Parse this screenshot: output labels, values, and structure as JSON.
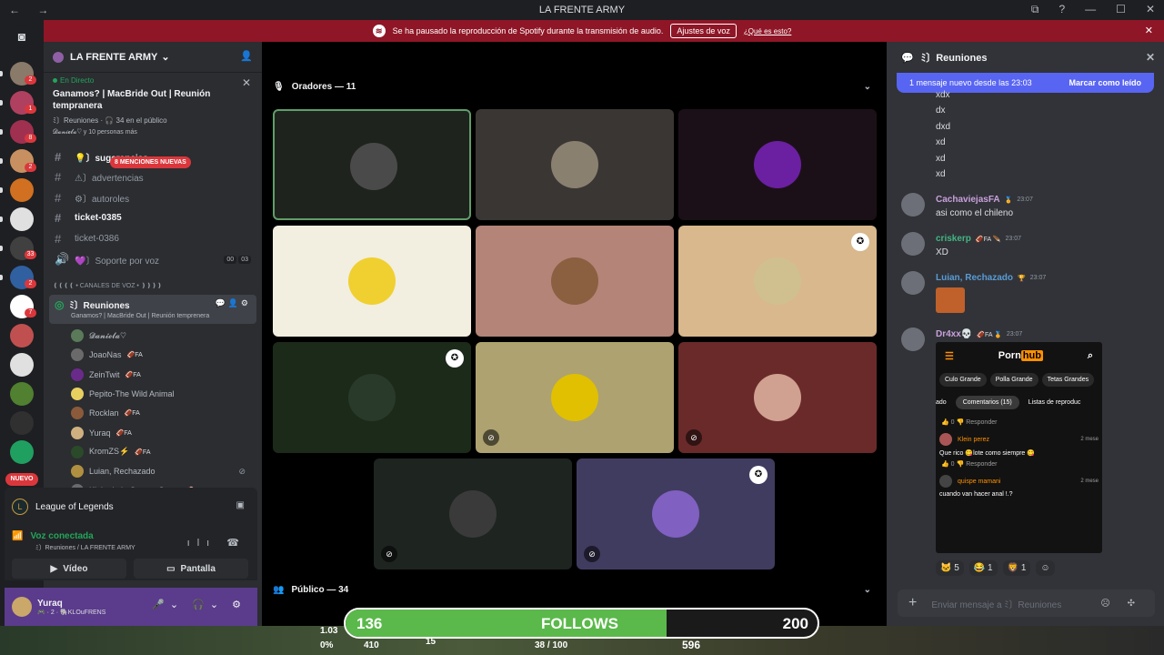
{
  "window": {
    "title": "LA FRENTE ARMY",
    "nav": "← →",
    "controls": [
      "⧉",
      "?",
      "—",
      "☐",
      "✕"
    ]
  },
  "banner": {
    "text": "Se ha pausado la reproducción de Spotify durante la transmisión de audio.",
    "button": "Ajustes de voz",
    "link": "¿Qué es esto?"
  },
  "guilds": [
    {
      "badge": "2",
      "color": "#8a7a6a"
    },
    {
      "badge": "1",
      "color": "#b04060"
    },
    {
      "badge": "8",
      "color": "#a03050"
    },
    {
      "badge": "2",
      "color": "#c89060"
    },
    {
      "badge": "",
      "color": "#d07020"
    },
    {
      "badge": "",
      "color": "#e0e0e0"
    },
    {
      "badge": "33",
      "color": "#404040"
    },
    {
      "badge": "2",
      "color": "#3060a0"
    },
    {
      "badge": "7",
      "color": "#ffffff"
    },
    {
      "badge": "",
      "color": "#c05050"
    },
    {
      "badge": "",
      "color": "#e0e0e0"
    },
    {
      "badge": "",
      "color": "#508030"
    },
    {
      "badge": "",
      "color": "#303030"
    },
    {
      "badge": "",
      "color": "#20a060"
    }
  ],
  "guild_new": "NUEVO",
  "server": {
    "name": "LA FRENTE ARMY"
  },
  "stage_card": {
    "live": "En Directo",
    "title": "Ganamos? | MacBride Out | Reunión tempranera",
    "channel": "ﾐ〕Reuniones",
    "audience": "34 en el público",
    "people": "𝓓𝓪𝓷𝓲𝓮𝓵𝓪♡ y 10 personas más"
  },
  "channels": [
    {
      "icon": "#",
      "name": "💡〕sugerencias",
      "unread": true
    },
    {
      "icon": "#",
      "name": "⚠〕advertencias",
      "unread": false
    },
    {
      "icon": "#",
      "name": "⚙〕autoroles",
      "unread": false
    },
    {
      "icon": "#",
      "name": "ticket-0385",
      "unread": true
    },
    {
      "icon": "#",
      "name": "ticket-0386",
      "unread": false
    },
    {
      "icon": "🔊",
      "name": "💜〕Soporte por voz",
      "unread": false
    }
  ],
  "mentions_badge": "8 MENCIONES NUEVAS",
  "voice_tags": [
    "00",
    "03"
  ],
  "voice_category": "❪❪❪❪ • CANALES DE VOZ • ❫❫❫❫",
  "voice_channel": {
    "name": "ﾐ〕Reuniones",
    "sub": "Ganamos? | MacBride Out | Reunión temprenera"
  },
  "voice_users": [
    {
      "name": "𝓓𝓪𝓷𝓲𝓮𝓵𝓪♡",
      "fa": "",
      "color": "#5a7a5a"
    },
    {
      "name": "JoaoNas",
      "fa": "🏈FA",
      "color": "#6a6a6a"
    },
    {
      "name": "ZeinTwit",
      "fa": "🏈FA",
      "color": "#6a2a8a"
    },
    {
      "name": "Pepito-The Wild Animal",
      "fa": "",
      "color": "#e8d060"
    },
    {
      "name": "Rocklan",
      "fa": "🏈FA",
      "color": "#8a5a3a"
    },
    {
      "name": "Yuraq",
      "fa": "🏈FA",
      "color": "#d0b080"
    },
    {
      "name": "KromZS⚡",
      "fa": "🏈FA",
      "color": "#2a4a2a"
    },
    {
      "name": "Luian, Rechazado",
      "fa": "",
      "color": "#b09040"
    },
    {
      "name": "Klein de la Cuenta Gemu",
      "fa": "🏈FA",
      "color": "#6a6a6a"
    }
  ],
  "panel": {
    "game": "League of Legends",
    "voice_status": "Voz conectada",
    "voice_detail": "ﾐ〕Reuniones / LA FRENTE ARMY",
    "video": "Vídeo",
    "screen": "Pantalla"
  },
  "user": {
    "name": "Yuraq",
    "status": "🎮 · 2 · 🐘KLOuFRENS"
  },
  "speakers_header": "Oradores — 11",
  "audience_header": "Público — 34",
  "tiles": [
    {
      "bg": "#1f231d",
      "av": "#4a4a4a",
      "mod": false,
      "muted": false
    },
    {
      "bg": "#3a3634",
      "av": "#8a8070",
      "mod": false,
      "muted": false
    },
    {
      "bg": "#1c1018",
      "av": "#6a20a0",
      "mod": false,
      "muted": false
    },
    {
      "bg": "#f2eee0",
      "av": "#f0d030",
      "mod": false,
      "muted": false
    },
    {
      "bg": "#b48478",
      "av": "#8a6040",
      "mod": false,
      "muted": false
    },
    {
      "bg": "#d8b88c",
      "av": "#d0c090",
      "mod": true,
      "muted": false
    },
    {
      "bg": "#1c2a1a",
      "av": "#2a3a2a",
      "mod": true,
      "muted": false
    },
    {
      "bg": "#aea270",
      "av": "#e0c000",
      "mod": false,
      "muted": true
    },
    {
      "bg": "#6a2a2a",
      "av": "#d0a090",
      "mod": false,
      "muted": true
    },
    {
      "bg": "#1e2420",
      "av": "#3a3a3a",
      "mod": false,
      "muted": true
    },
    {
      "bg": "#403c60",
      "av": "#8060c0",
      "mod": true,
      "muted": true
    }
  ],
  "chat": {
    "channel": "ﾐ〕Reuniones",
    "newbar": "1 mensaje nuevo desde las 23:03",
    "mark_read": "Marcar como leído",
    "lines": [
      "xdx",
      "dx",
      "dxd",
      "xd",
      "xd",
      "xd"
    ],
    "messages": [
      {
        "user": "CachaviejasFA",
        "color": "#c9a0dc",
        "time": "23:07",
        "text": "asi como el chileno",
        "fa": "🏅"
      },
      {
        "user": "criskerp",
        "color": "#43b581",
        "time": "23:07",
        "text": "XD",
        "fa": "🏈FA 🪶"
      },
      {
        "user": "Luian, Rechazado",
        "color": "#5a9bd5",
        "time": "23:07",
        "text": "",
        "fa": "🏆"
      },
      {
        "user": "Dr4xx💀",
        "color": "#c9a0dc",
        "time": "23:07",
        "text": "",
        "fa": "🏈FA 🏅"
      }
    ],
    "embed": {
      "logo1": "Porn",
      "logo2": "hub",
      "tags": [
        "Culo Grande",
        "Polla Grande",
        "Tetas Grandes"
      ],
      "tab_left": "ado",
      "tab_on": "Comentarios (15)",
      "tab_right": "Listas de reproduc",
      "reply": "Responder",
      "c1_name": "Klein perez",
      "c1_time": "2 mese",
      "c1_text": "Que rico 😋lote como siempre 😋",
      "c2_name": "quispe mamani",
      "c2_time": "2 mese",
      "c2_text": "cuando van hacer anal !.?",
      "likes": "0"
    },
    "reactions": [
      "🐱 5",
      "😂 1",
      "🦁 1",
      "☺"
    ],
    "placeholder": "Enviar mensaje a ﾐ〕Reuniones"
  },
  "overlay": {
    "current": "136",
    "label": "FOLLOWS",
    "goal": "200",
    "progress": 0.68,
    "hud": [
      "1.03",
      "0%",
      "410",
      "15",
      "38 / 100",
      "596"
    ]
  }
}
